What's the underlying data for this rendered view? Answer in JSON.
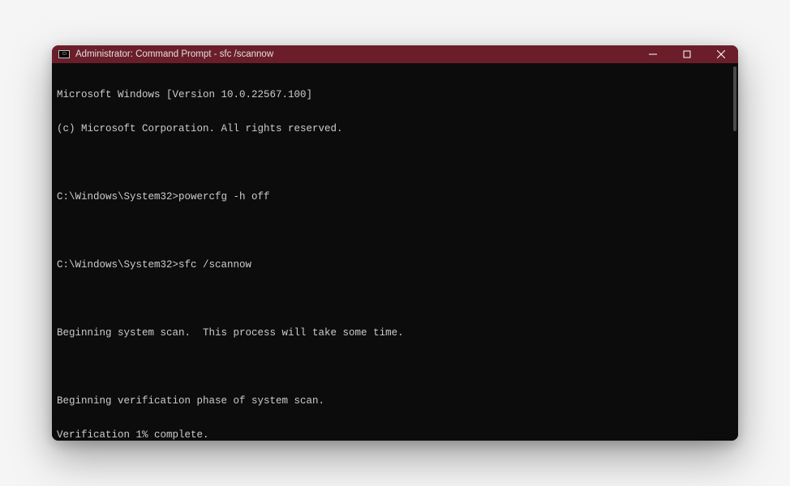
{
  "window": {
    "title": "Administrator: Command Prompt - sfc  /scannow",
    "icon_text": "C:\\"
  },
  "terminal": {
    "lines": [
      "Microsoft Windows [Version 10.0.22567.100]",
      "(c) Microsoft Corporation. All rights reserved.",
      "",
      "C:\\Windows\\System32>powercfg -h off",
      "",
      "C:\\Windows\\System32>sfc /scannow",
      "",
      "Beginning system scan.  This process will take some time.",
      "",
      "Beginning verification phase of system scan.",
      "Verification 1% complete."
    ]
  }
}
